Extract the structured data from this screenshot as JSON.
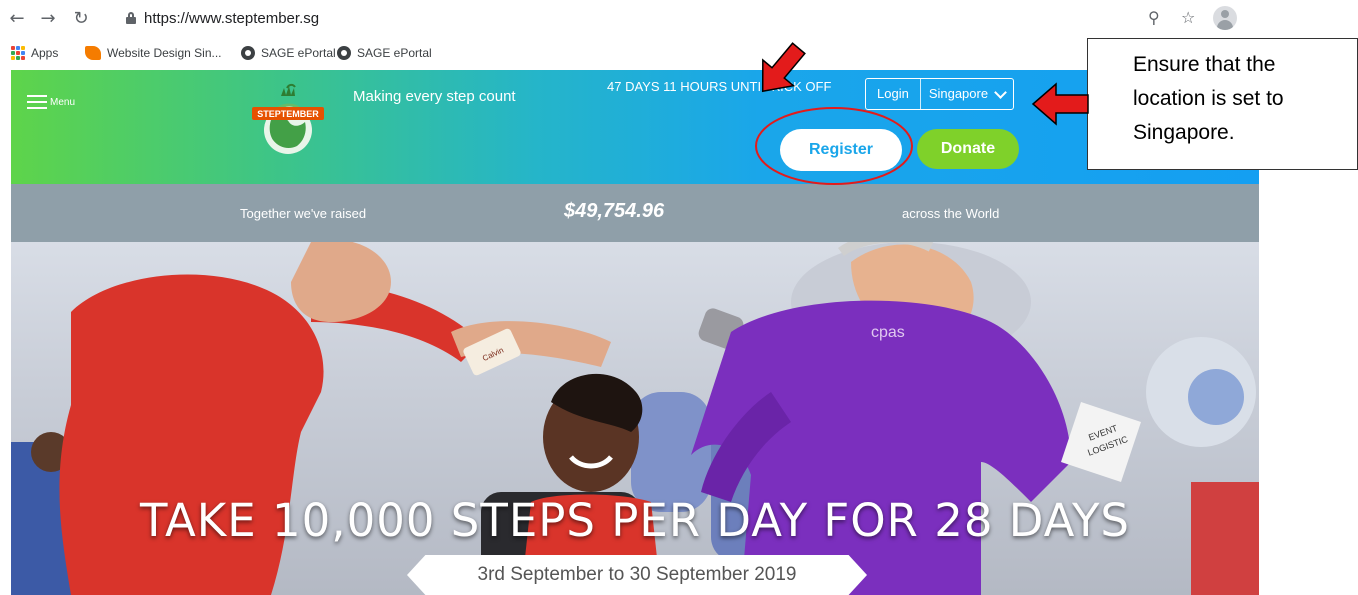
{
  "browser": {
    "url": "https://www.steptember.sg",
    "bookmarks": [
      {
        "label": "Apps",
        "icon": "apps-grid-icon"
      },
      {
        "label": "Website Design Sin...",
        "icon": "website-design-favicon"
      },
      {
        "label": "SAGE ePortal",
        "icon": "sage-favicon"
      },
      {
        "label": "SAGE ePortal",
        "icon": "sage-favicon"
      }
    ]
  },
  "header": {
    "menu_label": "Menu",
    "logo_text": "STEPTEMBER",
    "tagline": "Making every step count",
    "countdown": "47 DAYS 11 HOURS UNTIL KICK OFF",
    "login_label": "Login",
    "country": "Singapore",
    "register_label": "Register",
    "donate_label": "Donate"
  },
  "stats": {
    "label_left": "Together we've raised",
    "amount": "$49,754.96",
    "label_right": "across the World"
  },
  "hero": {
    "headline": "TAKE 10,000 STEPS PER DAY FOR 28 DAYS",
    "date_range": "3rd September to 30 September 2019",
    "badge_name": "Calvin",
    "shirt_logo": "cpas",
    "armband_text": [
      "EVENT",
      "LOGISTIC"
    ]
  },
  "annotation": {
    "callout_lines": [
      "Ensure that the",
      "location is set to",
      "Singapore."
    ]
  },
  "colors": {
    "header_gradient_start": "#5ed44a",
    "header_gradient_end": "#149ff2",
    "register_text": "#1aa6ea",
    "donate_bg": "#7fd12a",
    "stats_bg": "#8f9fa9",
    "annotation_red": "#e31b1b"
  }
}
